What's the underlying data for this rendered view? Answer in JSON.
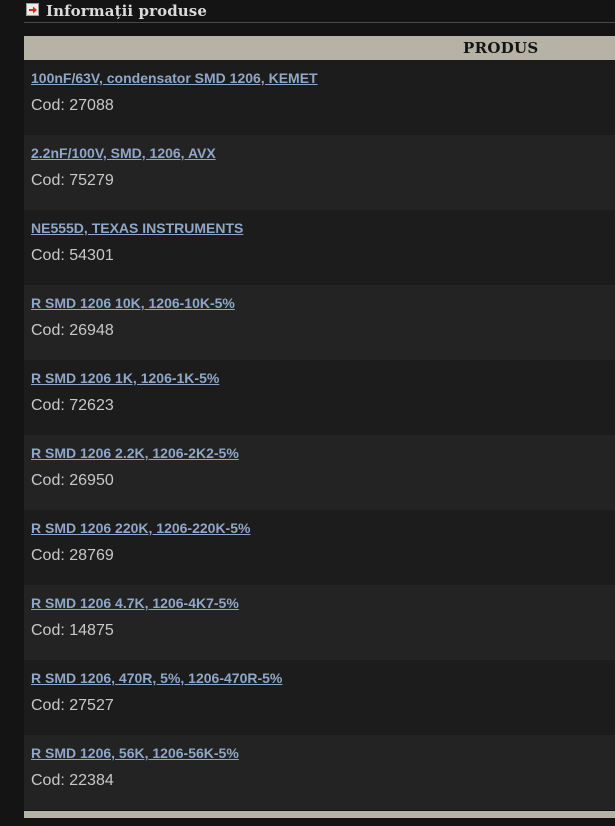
{
  "section": {
    "title": "Informații produse",
    "icon": "red-arrow-icon"
  },
  "table": {
    "column_header": "PRODUS",
    "rows": [
      {
        "name": "100nF/63V, condensator SMD 1206, KEMET",
        "code": "Cod: 27088"
      },
      {
        "name": "2.2nF/100V, SMD, 1206, AVX",
        "code": "Cod: 75279"
      },
      {
        "name": "NE555D, TEXAS INSTRUMENTS",
        "code": "Cod: 54301"
      },
      {
        "name": "R SMD 1206 10K, 1206-10K-5%",
        "code": "Cod: 26948"
      },
      {
        "name": "R SMD 1206 1K, 1206-1K-5%",
        "code": "Cod: 72623"
      },
      {
        "name": "R SMD 1206 2.2K, 1206-2K2-5%",
        "code": "Cod: 26950"
      },
      {
        "name": "R SMD 1206 220K, 1206-220K-5%",
        "code": "Cod: 28769"
      },
      {
        "name": "R SMD 1206 4.7K, 1206-4K7-5%",
        "code": "Cod: 14875"
      },
      {
        "name": "R SMD 1206, 470R, 5%, 1206-470R-5%",
        "code": "Cod: 27527"
      },
      {
        "name": "R SMD 1206, 56K, 1206-56K-5%",
        "code": "Cod: 22384"
      }
    ]
  },
  "colors": {
    "background": "#141414",
    "header_bar": "#b6b2a6",
    "link": "#8fa7c8",
    "text": "#c8c8c8",
    "row_odd": "#1c1c1c",
    "row_even": "#232323"
  }
}
